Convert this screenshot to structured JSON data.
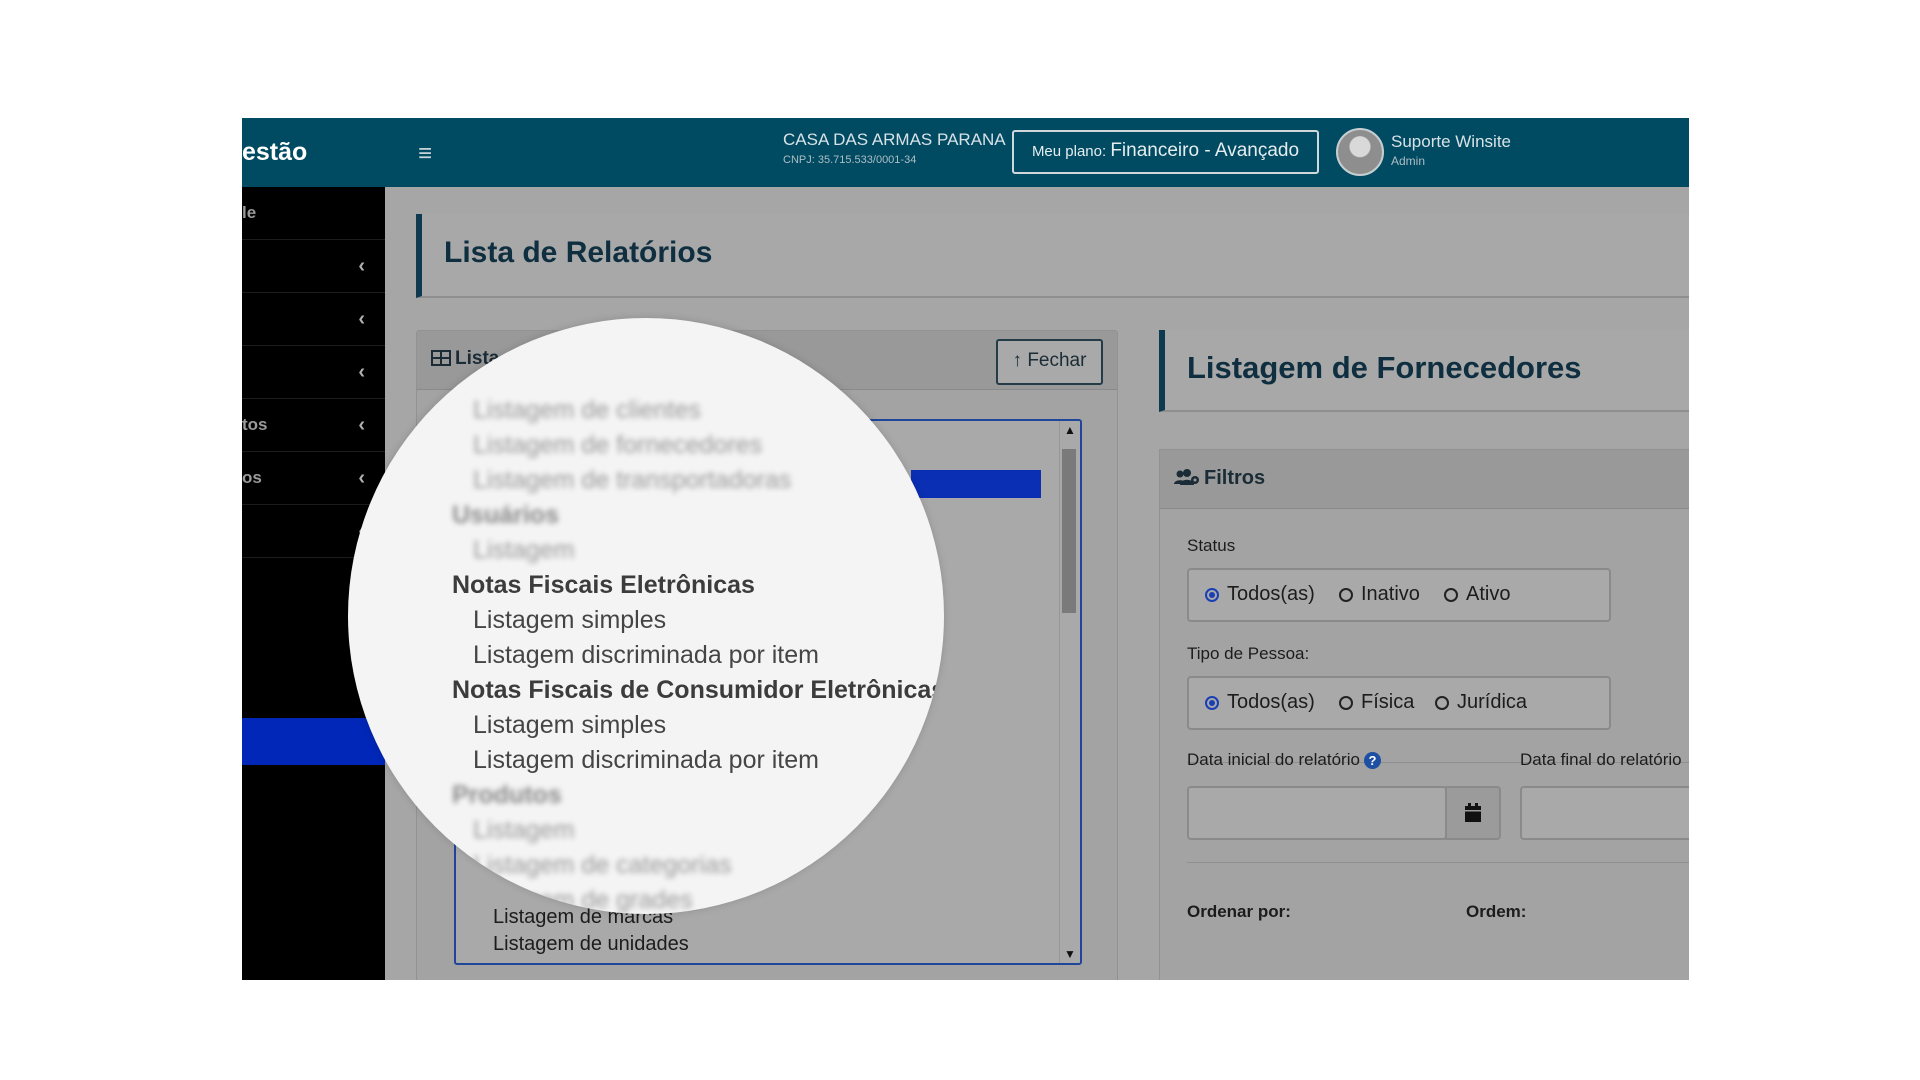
{
  "sidebar": {
    "logo_text": "estão",
    "items": [
      {
        "label": "le"
      },
      {
        "label": ""
      },
      {
        "label": ""
      },
      {
        "label": ""
      },
      {
        "label": "tos"
      },
      {
        "label": "os"
      },
      {
        "label": ""
      }
    ]
  },
  "topbar": {
    "company_name": "CASA DAS ARMAS PARANA",
    "cnpj": "CNPJ: 35.715.533/0001-34",
    "plan_prefix": "Meu plano:",
    "plan_value": "Financeiro - Avançado",
    "user_name": "Suporte Winsite",
    "user_role": "Admin"
  },
  "page": {
    "title": "Lista de Relatórios"
  },
  "list_card": {
    "title": "Lista",
    "close_label": "Fechar",
    "visible_rows": [
      "Listagem de marcas",
      "Listagem de unidades"
    ]
  },
  "magnifier": {
    "rows": [
      {
        "text": "Listagem de clientes",
        "type": "item",
        "blur": true
      },
      {
        "text": "Listagem de fornecedores",
        "type": "item",
        "blur": true
      },
      {
        "text": "Listagem de transportadoras",
        "type": "item",
        "blur": true
      },
      {
        "text": "Usuários",
        "type": "head",
        "blur": true
      },
      {
        "text": "Listagem",
        "type": "item",
        "blur": true
      },
      {
        "text": "Notas Fiscais Eletrônicas",
        "type": "head",
        "blur": false
      },
      {
        "text": "Listagem simples",
        "type": "item",
        "blur": false
      },
      {
        "text": "Listagem discriminada por item",
        "type": "item",
        "blur": false
      },
      {
        "text": "Notas Fiscais de Consumidor Eletrônicas",
        "type": "head",
        "blur": false
      },
      {
        "text": "Listagem simples",
        "type": "item",
        "blur": false
      },
      {
        "text": "Listagem discriminada por item",
        "type": "item",
        "blur": false
      },
      {
        "text": "Produtos",
        "type": "head",
        "blur": true
      },
      {
        "text": "Listagem",
        "type": "item",
        "blur": true
      },
      {
        "text": "Listagem de categorias",
        "type": "item",
        "blur": true
      },
      {
        "text": "Listagem de grades",
        "type": "item",
        "blur": true
      }
    ]
  },
  "report": {
    "title": "Listagem de Fornecedores",
    "filters_title": "Filtros",
    "status_label": "Status",
    "status_options": [
      "Todos(as)",
      "Inativo",
      "Ativo"
    ],
    "status_selected": "Todos(as)",
    "person_label": "Tipo de Pessoa:",
    "person_options": [
      "Todos(as)",
      "Física",
      "Jurídica"
    ],
    "person_selected": "Todos(as)",
    "date_start_label": "Data inicial do relatório",
    "date_end_label": "Data final do relatório",
    "order_by_label": "Ordenar por:",
    "order_label": "Ordem:"
  },
  "colors": {
    "topbar": "#004a62",
    "sidebar_active": "#0027b8",
    "listbox_selected": "#0a2fb4",
    "radio_accent": "#1a3fb4"
  }
}
